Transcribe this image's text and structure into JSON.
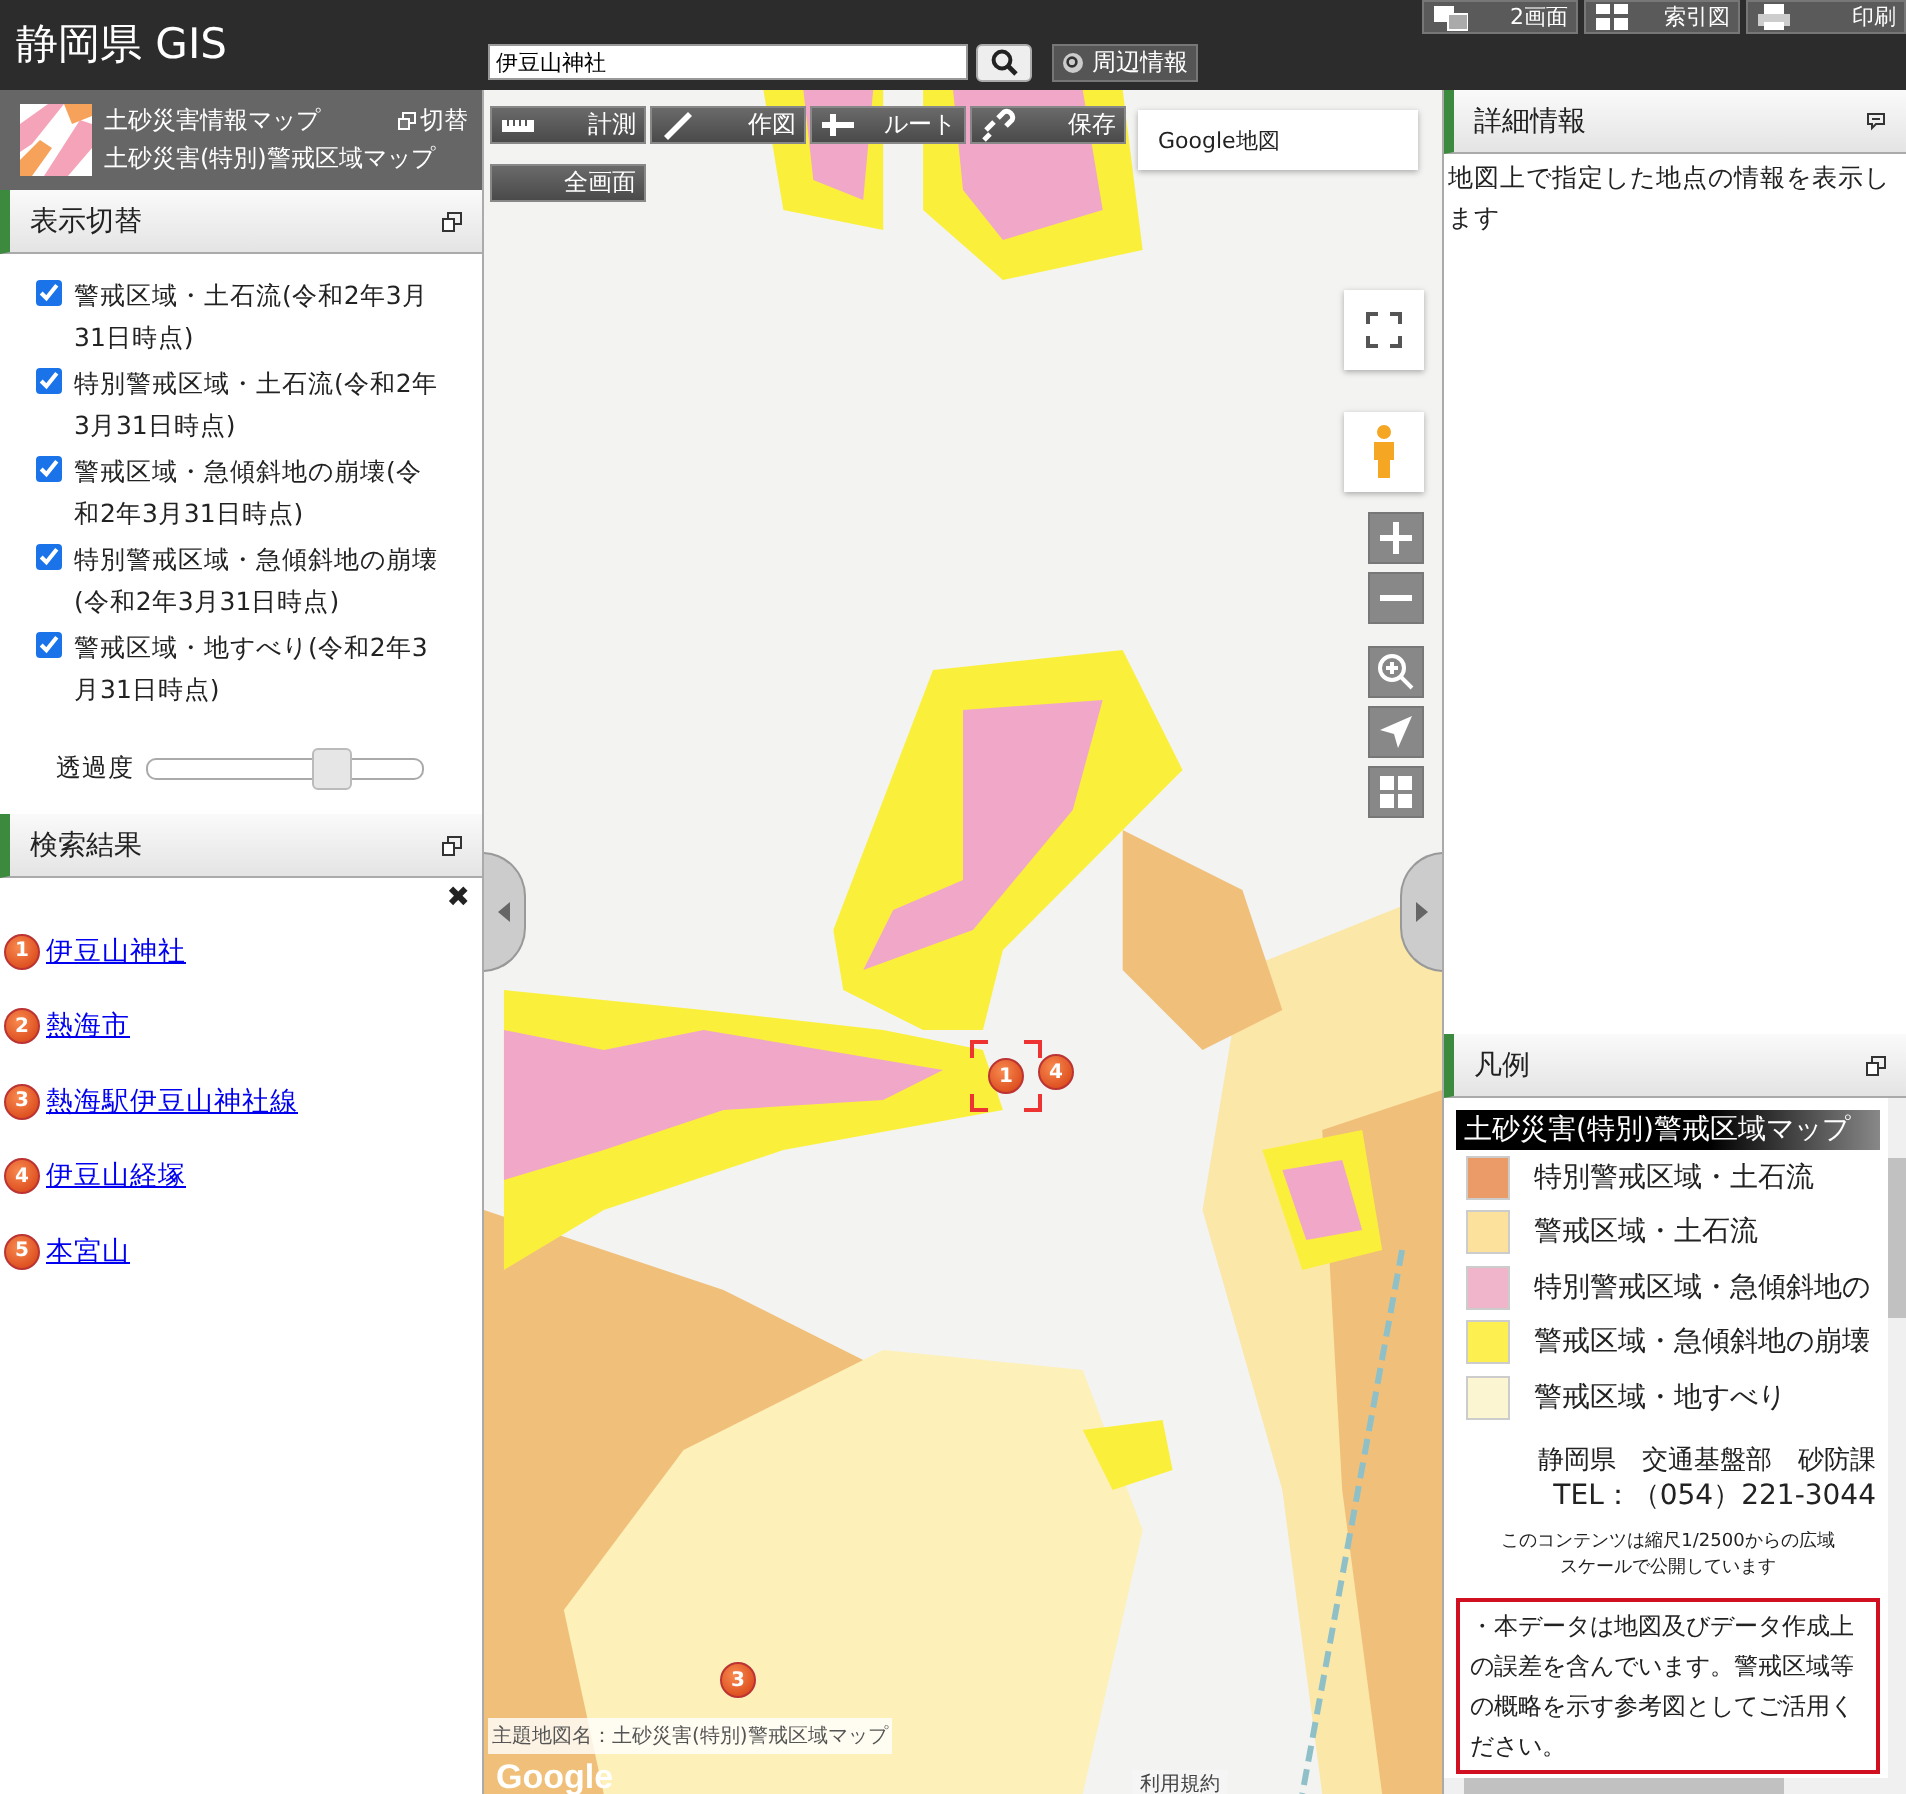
{
  "header": {
    "title": "静岡県 GIS",
    "search": {
      "value": "伊豆山神社"
    },
    "nearby_button": "周辺情報",
    "tools": [
      "2画面",
      "索引図",
      "印刷"
    ]
  },
  "theme": {
    "title": "土砂災害情報マップ",
    "switch_link": "切替",
    "subtitle": "土砂災害(特別)警戒区域マップ"
  },
  "layers_panel": {
    "title": "表示切替",
    "layers": [
      {
        "label": "警戒区域・土石流(令和2年3月31日時点)",
        "checked": true
      },
      {
        "label": "特別警戒区域・土石流(令和2年3月31日時点)",
        "checked": true
      },
      {
        "label": "警戒区域・急傾斜地の崩壊(令和2年3月31日時点)",
        "checked": true
      },
      {
        "label": "特別警戒区域・急傾斜地の崩壊(令和2年3月31日時点)",
        "checked": true
      },
      {
        "label": "警戒区域・地すべり(令和2年3月31日時点)",
        "checked": true
      }
    ],
    "opacity": {
      "label": "透過度",
      "level": 0.68
    }
  },
  "results_panel": {
    "title": "検索結果",
    "close": "✖",
    "results": [
      {
        "number": "1",
        "name": "伊豆山神社"
      },
      {
        "number": "2",
        "name": "熱海市"
      },
      {
        "number": "3",
        "name": "熱海駅伊豆山神社線"
      },
      {
        "number": "4",
        "name": "伊豆山経塚"
      },
      {
        "number": "5",
        "name": "本宮山"
      }
    ]
  },
  "map": {
    "toolbar": [
      "計測",
      "作図",
      "ルート",
      "保存"
    ],
    "fullscreen_button": "全画面",
    "basemap": "Google地図",
    "markers": [
      {
        "number": "4",
        "kind": "pin"
      },
      {
        "number": "3",
        "kind": "pin"
      },
      {
        "number": "1",
        "kind": "target"
      }
    ],
    "theme_caption": "主題地図名：土砂災害(特別)警戒区域マップ",
    "logo": "Google",
    "terms_link": "利用規約"
  },
  "detail_panel": {
    "title": "詳細情報",
    "text": "地図上で指定した地点の情報を表示します"
  },
  "legend_panel": {
    "title": "凡例",
    "heading": "土砂災害(特別)警戒区域マップ",
    "items": [
      {
        "label": "特別警戒区域・土石流",
        "color": "#eb9b67"
      },
      {
        "label": "警戒区域・土石流",
        "color": "#fbe19c"
      },
      {
        "label": "特別警戒区域・急傾斜地の",
        "color": "#f1b5cb"
      },
      {
        "label": "警戒区域・急傾斜地の崩壊",
        "color": "#fcef4f"
      },
      {
        "label": "警戒区域・地すべり",
        "color": "#fcf5d2"
      }
    ],
    "office": "静岡県　交通基盤部　砂防課",
    "tel": "TEL：（054）221-3044",
    "scale_note": "このコンテンツは縮尺1/2500からの広域スケールで公開しています",
    "notice": "・本データは地図及びデータ作成上の誤差を含んでいます。警戒区域等の概略を示す参考図としてご活用ください。"
  }
}
